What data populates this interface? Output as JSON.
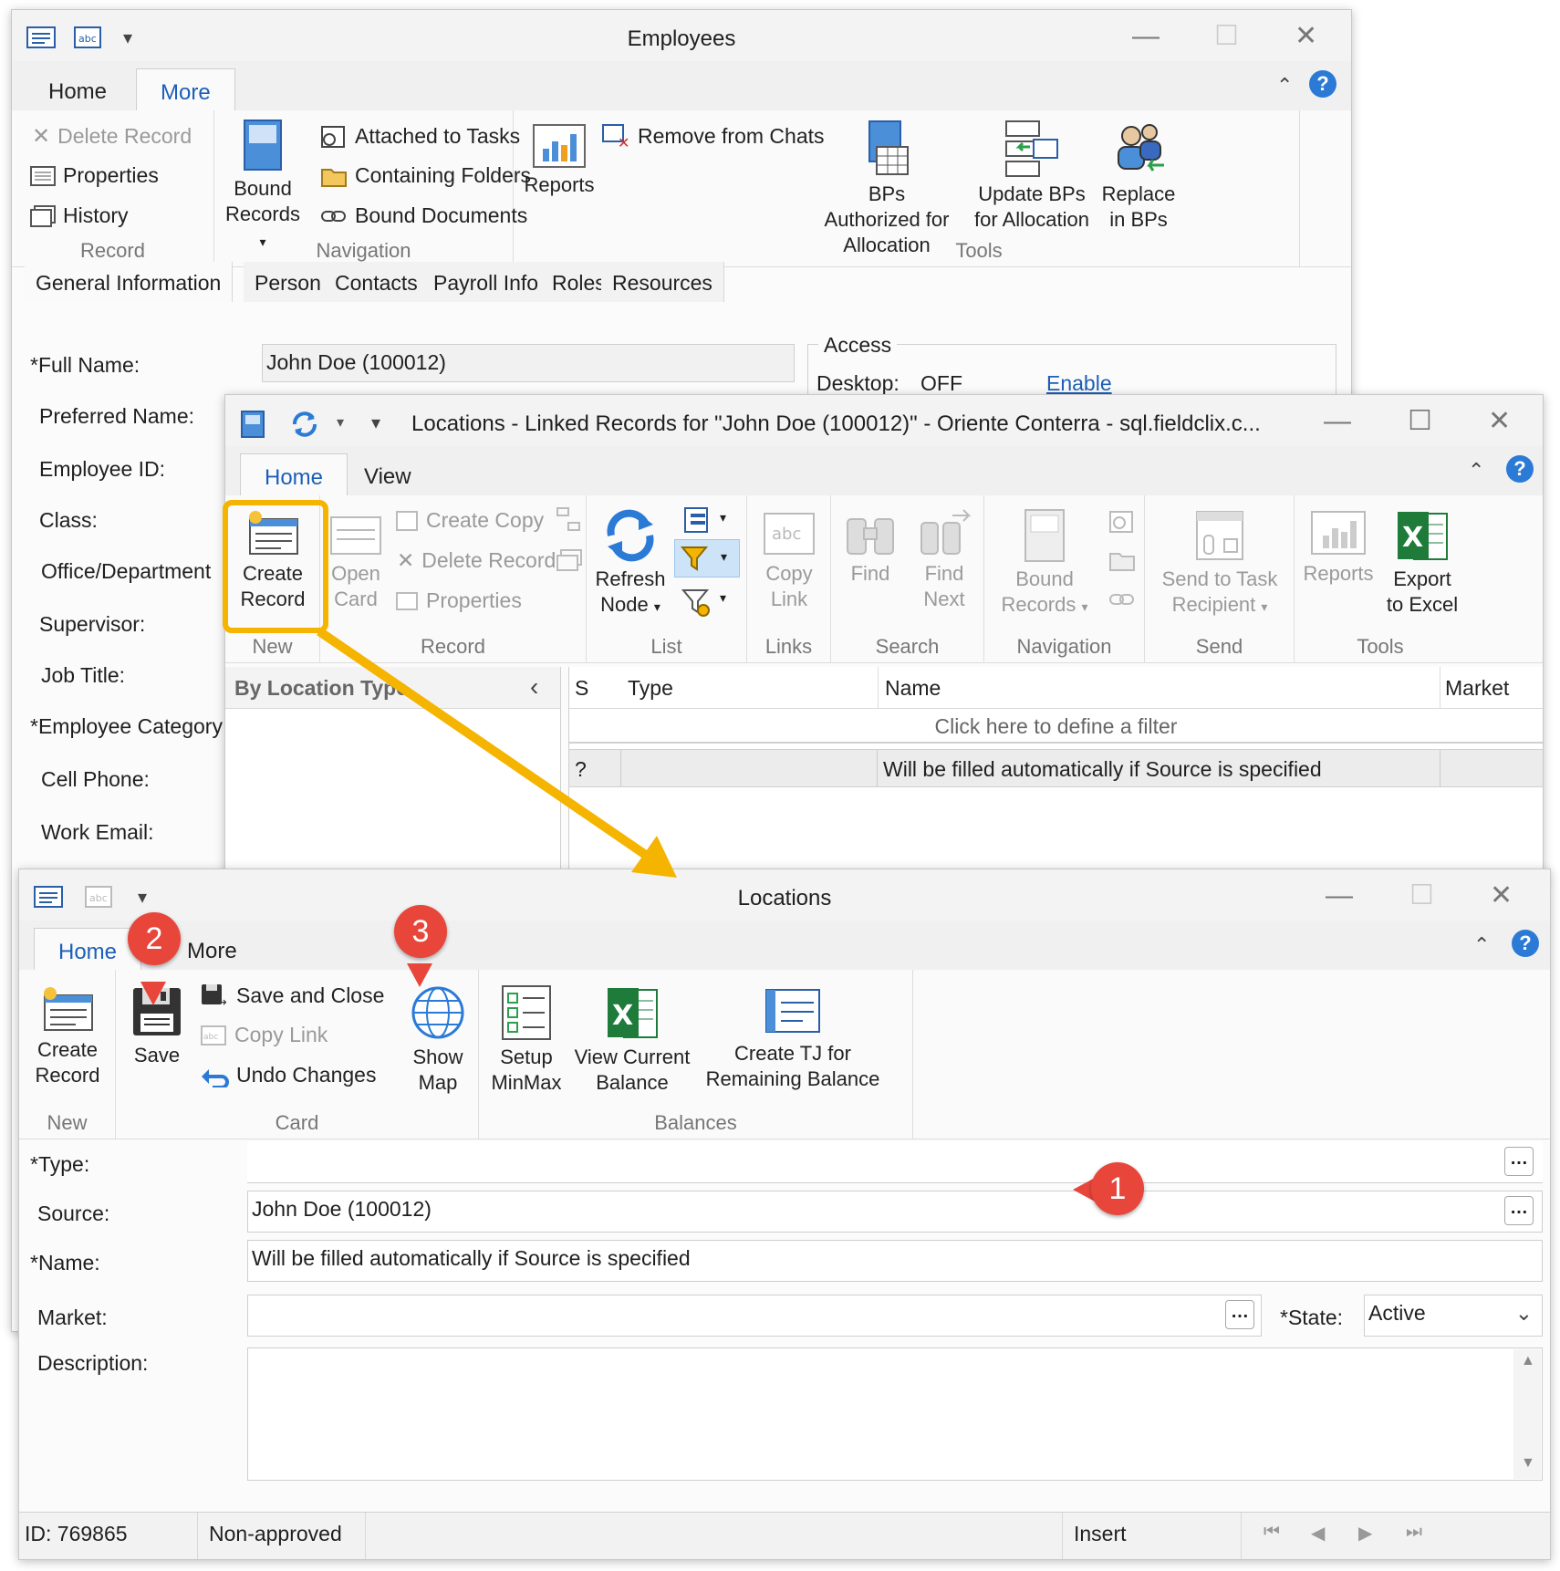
{
  "employees": {
    "title": "Employees",
    "tabs": [
      "Home",
      "More"
    ],
    "record_group": {
      "label": "Record",
      "delete": "Delete Record",
      "properties": "Properties",
      "history": "History"
    },
    "navigation_group": {
      "label": "Navigation",
      "bound_records": "Bound Records",
      "attached_tasks": "Attached to Tasks",
      "containing_folders": "Containing Folders",
      "bound_documents": "Bound Documents"
    },
    "reports": "Reports",
    "remove_chats": "Remove from Chats",
    "tools_group": {
      "label": "Tools",
      "bps_authorized": "BPs Authorized for Allocation",
      "update_bps": "Update BPs for Allocation",
      "replace_bps": "Replace in BPs"
    },
    "subtabs": [
      "General Information",
      "Person",
      "Contacts",
      "Payroll Info",
      "Roles",
      "Resources"
    ],
    "form_labels": [
      "*Full Name:",
      "Preferred Name:",
      "Employee ID:",
      "Class:",
      "Office/Department",
      "Supervisor:",
      "Job Title:",
      "*Employee Category",
      "Cell Phone:",
      "Work Email:"
    ],
    "full_name_value": "John Doe (100012)",
    "access": {
      "label": "Access",
      "desktop_label": "Desktop:",
      "desktop_value": "OFF",
      "enable_link": "Enable"
    }
  },
  "linked": {
    "title": "Locations - Linked Records for \"John Doe (100012)\" - Oriente Conterra - sql.fieldclix.c...",
    "tabs": [
      "Home",
      "View"
    ],
    "new_group": {
      "label": "New",
      "create_record": "Create Record"
    },
    "record_group": {
      "label": "Record",
      "open_card": "Open Card",
      "create_copy": "Create Copy",
      "delete_record": "Delete Record",
      "properties": "Properties"
    },
    "list_group": {
      "label": "List",
      "refresh_node": "Refresh Node"
    },
    "links_group": {
      "label": "Links",
      "copy_link": "Copy Link"
    },
    "search_group": {
      "label": "Search",
      "find": "Find",
      "find_next": "Find Next"
    },
    "navigation_group": {
      "label": "Navigation",
      "bound_records": "Bound Records"
    },
    "send_group": {
      "label": "Send",
      "send_task": "Send to Task Recipient"
    },
    "tools_group": {
      "label": "Tools",
      "reports": "Reports",
      "export_excel": "Export to Excel"
    },
    "tree_header": "By Location Type",
    "columns": [
      "S",
      "Type",
      "Name",
      "Market"
    ],
    "filter_hint": "Click here to define a filter",
    "row": {
      "s": "?",
      "type": "",
      "name": "Will be filled automatically if Source is specified"
    }
  },
  "locations": {
    "title": "Locations",
    "tabs": [
      "Home",
      "More"
    ],
    "new_group": {
      "label": "New",
      "create_record": "Create Record"
    },
    "card_group": {
      "label": "Card",
      "save": "Save",
      "save_close": "Save and Close",
      "copy_link": "Copy Link",
      "undo": "Undo Changes",
      "show_map": "Show Map"
    },
    "balances_group": {
      "label": "Balances",
      "setup_minmax": "Setup MinMax",
      "view_balance": "View Current Balance",
      "create_tj": "Create TJ for Remaining Balance"
    },
    "fields": {
      "type_label": "*Type:",
      "type_value": "",
      "source_label": "Source:",
      "source_value": "John Doe (100012)",
      "name_label": "*Name:",
      "name_value": "Will be filled automatically if Source is specified",
      "market_label": "Market:",
      "market_value": "",
      "state_label": "*State:",
      "state_value": "Active",
      "description_label": "Description:",
      "description_value": ""
    },
    "status": {
      "id": "ID: 769865",
      "approval": "Non-approved",
      "mode": "Insert"
    }
  },
  "markers": [
    "1",
    "2",
    "3"
  ],
  "colors": {
    "accent": "#1c5fb8",
    "highlight": "#f5b400",
    "marker": "#e8463a",
    "excel": "#1e7b3a"
  }
}
